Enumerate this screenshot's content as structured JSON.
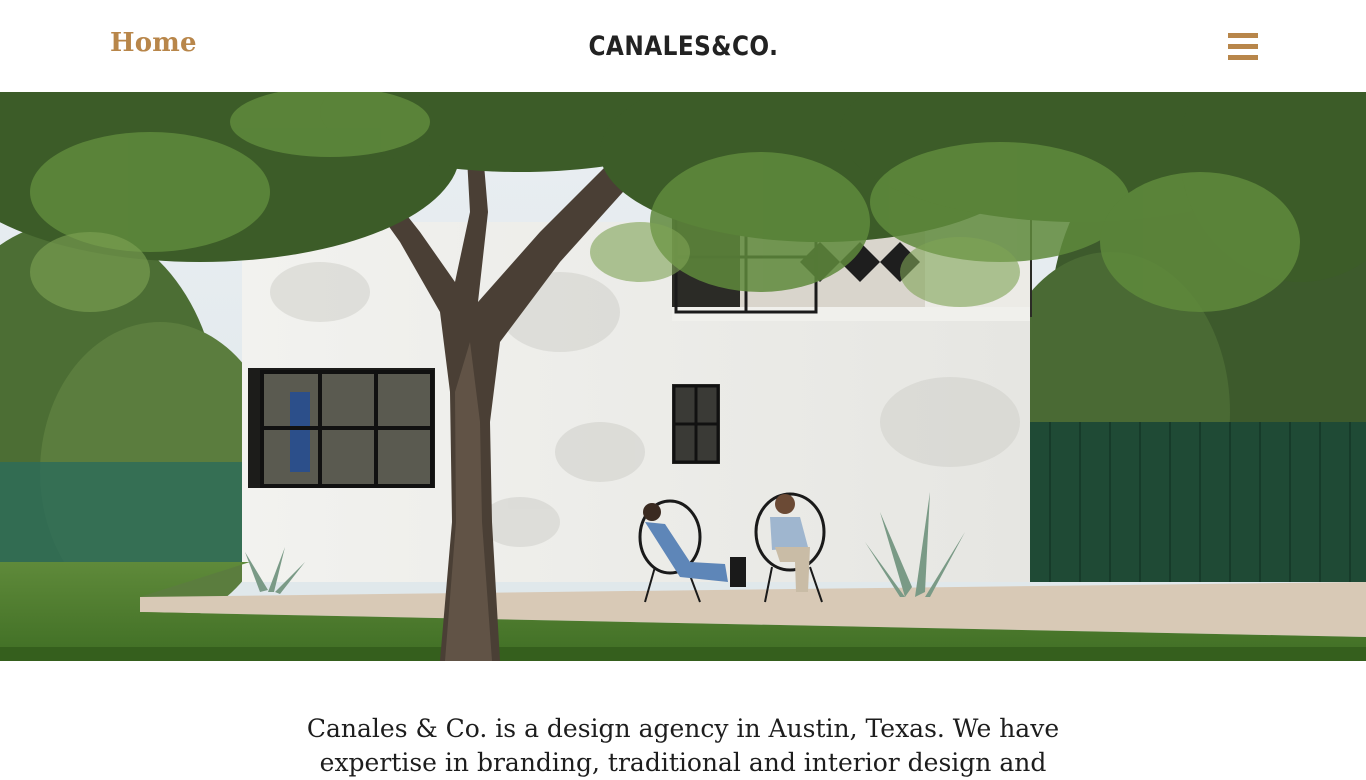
{
  "header": {
    "home_label": "Home",
    "logo": "CANALES&CO.",
    "menu_icon": "hamburger-menu-icon"
  },
  "hero": {
    "image_subject": "white stucco house with tree and two people on patio chairs"
  },
  "intro": {
    "text": "Canales & Co. is a design agency in Austin, Texas. We have expertise in branding, traditional and interior design and"
  },
  "colors": {
    "accent": "#b8864a",
    "text": "#1d1d1d",
    "background": "#ffffff"
  }
}
